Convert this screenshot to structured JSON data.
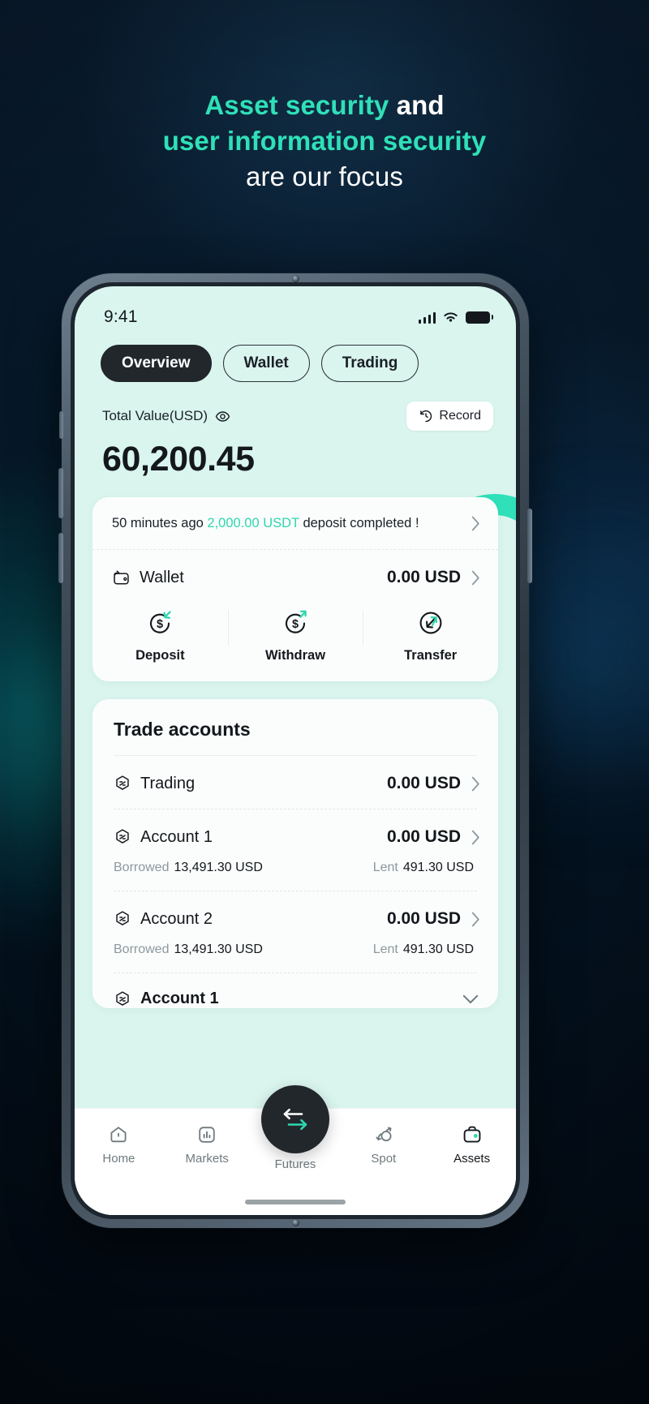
{
  "headline": {
    "line1_accent": "Asset security",
    "line1_rest": " and",
    "line2": "user information security",
    "line3": "are our focus"
  },
  "colors": {
    "accent_teal": "#2fe0b8",
    "amount_teal": "#2fd6ad",
    "dark": "#22272c",
    "screen_bg": "#d9f5ee"
  },
  "status_bar": {
    "time": "9:41",
    "signal_icon": "cellular-signal-icon",
    "wifi_icon": "wifi-icon",
    "battery_icon": "battery-icon"
  },
  "tabs": [
    {
      "label": "Overview",
      "active": true
    },
    {
      "label": "Wallet",
      "active": false
    },
    {
      "label": "Trading",
      "active": false
    }
  ],
  "total": {
    "label": "Total Value(USD)",
    "eye_icon": "eye-icon",
    "amount": "60,200.45",
    "record_label": "Record",
    "record_icon": "history-clock-icon"
  },
  "notice": {
    "prefix": "50 minutes ago ",
    "amount": "2,000.00 USDT",
    "suffix": " deposit completed !",
    "chevron_icon": "chevron-right-icon"
  },
  "wallet": {
    "icon": "wallet-icon",
    "label": "Wallet",
    "value": "0.00 USD",
    "chevron_icon": "chevron-right-icon"
  },
  "actions": [
    {
      "label": "Deposit",
      "icon": "deposit-arrow-in-icon"
    },
    {
      "label": "Withdraw",
      "icon": "withdraw-arrow-out-icon"
    },
    {
      "label": "Transfer",
      "icon": "transfer-arrow-icon"
    }
  ],
  "trade_accounts": {
    "title": "Trade accounts",
    "rows": [
      {
        "icon": "account-hex-icon",
        "name": "Trading",
        "value": "0.00 USD",
        "has_sub": false,
        "borrowed_key": "",
        "borrowed_val": "",
        "lent_key": "",
        "lent_val": ""
      },
      {
        "icon": "account-hex-icon",
        "name": "Account 1",
        "value": "0.00 USD",
        "has_sub": true,
        "borrowed_key": "Borrowed",
        "borrowed_val": "13,491.30 USD",
        "lent_key": "Lent",
        "lent_val": "491.30 USD"
      },
      {
        "icon": "account-hex-icon",
        "name": "Account 2",
        "value": "0.00 USD",
        "has_sub": true,
        "borrowed_key": "Borrowed",
        "borrowed_val": "13,491.30 USD",
        "lent_key": "Lent",
        "lent_val": "491.30 USD"
      }
    ],
    "collapsed_row": {
      "icon": "account-hex-icon",
      "name": "Account 1",
      "chevron_icon": "chevron-down-icon"
    }
  },
  "bottom_nav": [
    {
      "label": "Home",
      "icon": "home-icon",
      "active": false
    },
    {
      "label": "Markets",
      "icon": "bar-chart-icon",
      "active": false
    },
    {
      "label": "Futures",
      "icon": "swap-arrows-icon",
      "active": false
    },
    {
      "label": "Spot",
      "icon": "spot-swap-icon",
      "active": false
    },
    {
      "label": "Assets",
      "icon": "briefcase-assets-icon",
      "active": true
    }
  ]
}
